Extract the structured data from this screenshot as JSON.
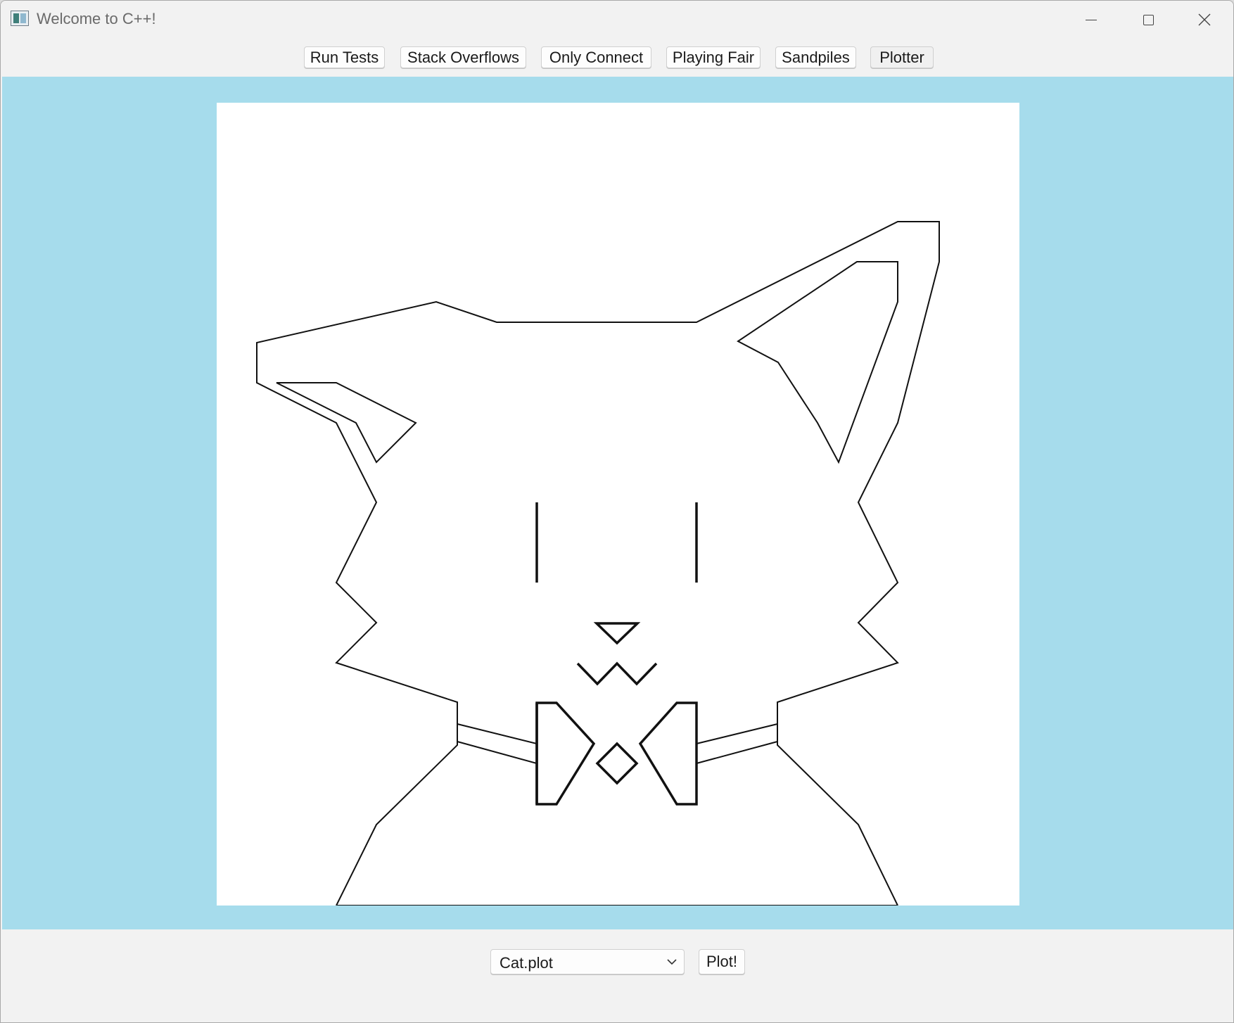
{
  "window": {
    "title": "Welcome to C++!"
  },
  "toolbar": {
    "buttons": [
      {
        "label": "Run Tests"
      },
      {
        "label": "Stack Overflows"
      },
      {
        "label": "Only Connect"
      },
      {
        "label": "Playing Fair"
      },
      {
        "label": "Sandpiles"
      },
      {
        "label": "Plotter",
        "active": true
      }
    ]
  },
  "canvas": {
    "drawing": "cat",
    "icon": "cat-drawing-icon"
  },
  "bottom": {
    "file_select_value": "Cat.plot",
    "plot_button_label": "Plot!"
  },
  "colors": {
    "stage_background": "#a6dcec",
    "canvas_background": "#ffffff",
    "window_background": "#f2f2f2"
  }
}
